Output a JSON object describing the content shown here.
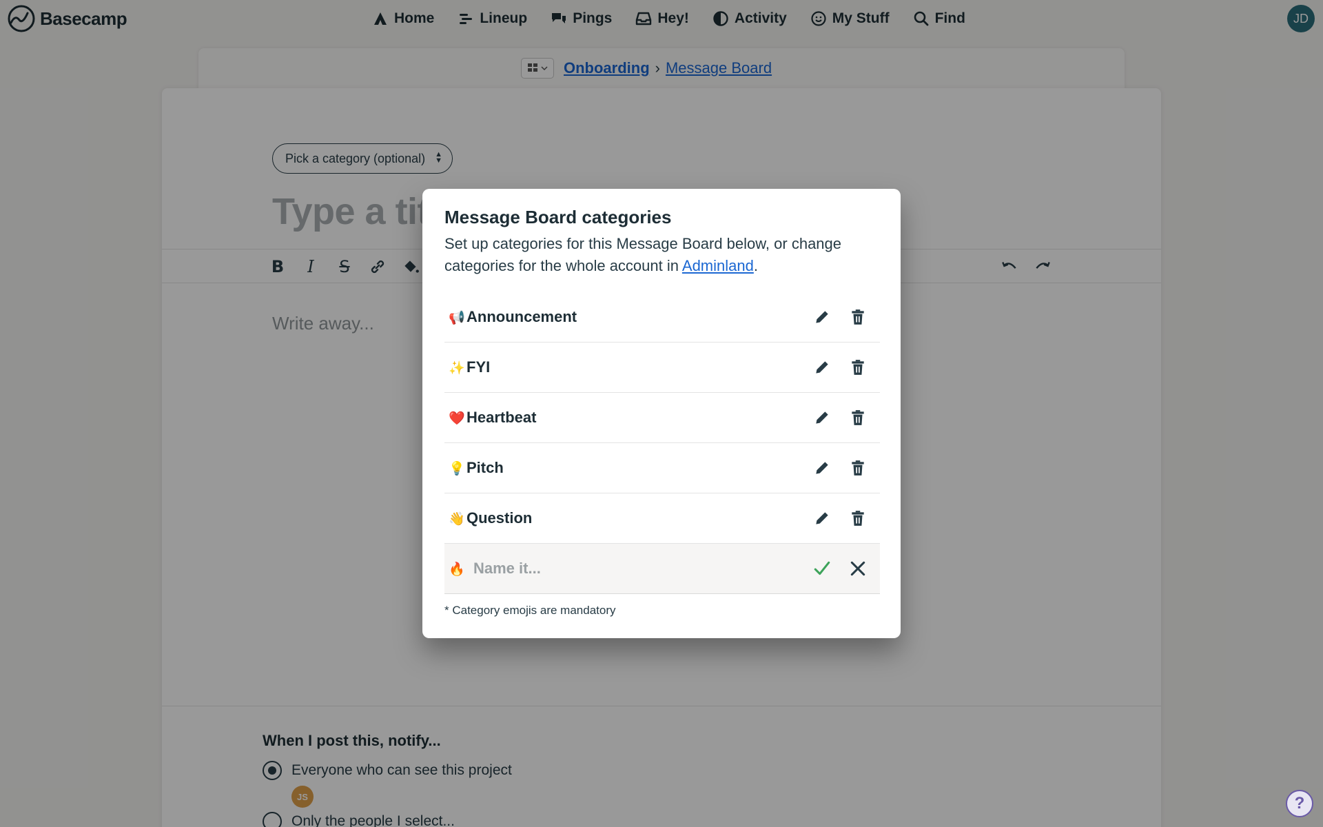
{
  "app": {
    "name": "Basecamp"
  },
  "nav": {
    "items": [
      {
        "label": "Home",
        "icon": "home-icon"
      },
      {
        "label": "Lineup",
        "icon": "lineup-icon"
      },
      {
        "label": "Pings",
        "icon": "pings-icon"
      },
      {
        "label": "Hey!",
        "icon": "inbox-icon"
      },
      {
        "label": "Activity",
        "icon": "activity-icon"
      },
      {
        "label": "My Stuff",
        "icon": "smiley-icon"
      },
      {
        "label": "Find",
        "icon": "search-icon"
      }
    ],
    "user_initials": "JD"
  },
  "breadcrumb": {
    "project": "Onboarding",
    "separator": "›",
    "current": "Message Board"
  },
  "editor": {
    "category_picker": "Pick a category (optional)",
    "title_placeholder": "Type a tit",
    "body_placeholder": "Write away..."
  },
  "notify": {
    "heading": "When I post this, notify...",
    "option_everyone": "Everyone who can see this project",
    "avatar_initials": "JS",
    "option_select": "Only the people I select..."
  },
  "modal": {
    "title": "Message Board categories",
    "desc_before": "Set up categories for this Message Board below, or change categories for the whole account in ",
    "desc_link": "Adminland",
    "desc_after": ".",
    "categories": [
      {
        "emoji": "📢",
        "name": "Announcement"
      },
      {
        "emoji": "✨",
        "name": "FYI"
      },
      {
        "emoji": "❤️",
        "name": "Heartbeat"
      },
      {
        "emoji": "💡",
        "name": "Pitch"
      },
      {
        "emoji": "👋",
        "name": "Question"
      }
    ],
    "new_category": {
      "emoji": "🔥",
      "placeholder": "Name it..."
    },
    "footnote": "* Category emojis are mandatory"
  },
  "help": {
    "label": "?"
  }
}
